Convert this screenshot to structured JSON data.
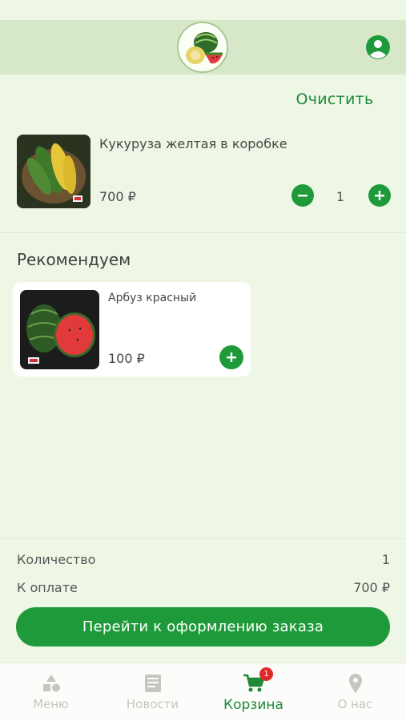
{
  "header": {
    "logo_icon": "watermelon-melon-logo",
    "profile_icon": "user-circle-icon"
  },
  "cart": {
    "clear_label": "Очистить",
    "items": [
      {
        "name": "Кукуруза желтая в коробке",
        "price": "700 ₽",
        "quantity": "1",
        "image": "corn-in-box"
      }
    ]
  },
  "recommend": {
    "title": "Рекомендуем",
    "items": [
      {
        "name": "Арбуз красный",
        "price": "100 ₽",
        "image": "red-watermelon"
      }
    ]
  },
  "summary": {
    "quantity_label": "Количество",
    "quantity_value": "1",
    "total_label": "К оплате",
    "total_value": "700 ₽",
    "checkout_label": "Перейти к оформлению заказа"
  },
  "tabbar": {
    "tabs": [
      {
        "label": "Меню",
        "icon": "shapes-icon",
        "active": false
      },
      {
        "label": "Новости",
        "icon": "newspaper-icon",
        "active": false
      },
      {
        "label": "Корзина",
        "icon": "cart-icon",
        "active": true,
        "badge": "1"
      },
      {
        "label": "О нас",
        "icon": "location-pin-icon",
        "active": false
      }
    ]
  },
  "colors": {
    "accent": "#1e9a3a",
    "background": "#eef7e6",
    "header": "#d6e8c8",
    "badge": "#e02a2a"
  }
}
